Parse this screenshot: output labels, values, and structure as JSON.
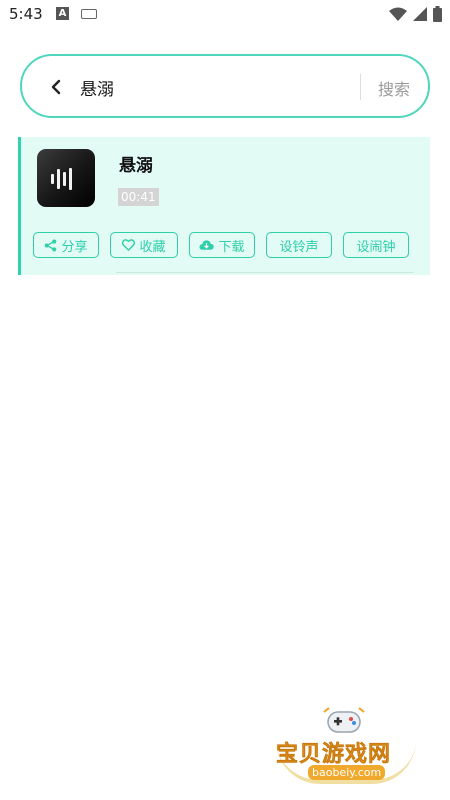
{
  "status_bar": {
    "time": "5:43",
    "left_icons": [
      "a-notification-icon",
      "keyboard-icon"
    ],
    "right_icons": [
      "wifi-icon",
      "signal-icon",
      "battery-icon"
    ]
  },
  "search": {
    "query": "悬溺",
    "button_label": "搜索",
    "accent_color": "#4fd6bd"
  },
  "results": [
    {
      "title": "悬溺",
      "duration": "00:41",
      "actions": [
        {
          "label": "分享",
          "icon": "share-icon"
        },
        {
          "label": "收藏",
          "icon": "heart-icon"
        },
        {
          "label": "下载",
          "icon": "cloud-download-icon"
        },
        {
          "label": "设铃声"
        },
        {
          "label": "设闹钟"
        }
      ]
    }
  ],
  "watermark": {
    "text": "宝贝游戏网",
    "url": "baobeiy.com"
  }
}
